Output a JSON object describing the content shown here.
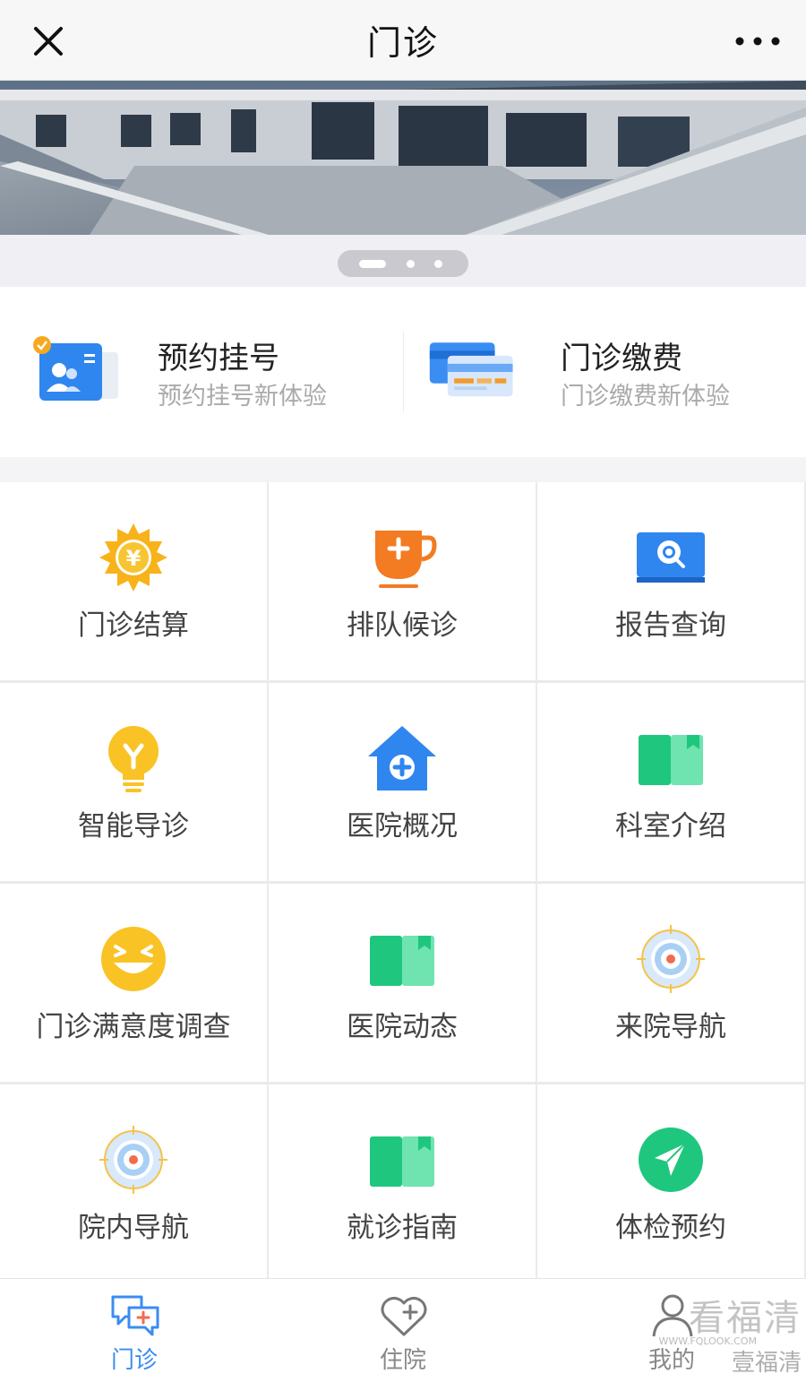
{
  "header": {
    "title": "门诊"
  },
  "quick": [
    {
      "title": "预约挂号",
      "subtitle": "预约挂号新体验"
    },
    {
      "title": "门诊缴费",
      "subtitle": "门诊缴费新体验"
    }
  ],
  "grid": [
    {
      "label": "门诊结算"
    },
    {
      "label": "排队候诊"
    },
    {
      "label": "报告查询"
    },
    {
      "label": "智能导诊"
    },
    {
      "label": "医院概况"
    },
    {
      "label": "科室介绍"
    },
    {
      "label": "门诊满意度调查"
    },
    {
      "label": "医院动态"
    },
    {
      "label": "来院导航"
    },
    {
      "label": "院内导航"
    },
    {
      "label": "就诊指南"
    },
    {
      "label": "体检预约"
    }
  ],
  "tabs": [
    {
      "label": "门诊",
      "active": true
    },
    {
      "label": "住院",
      "active": false
    },
    {
      "label": "我的",
      "active": false
    }
  ],
  "watermark": {
    "logo": "看福清",
    "url": "WWW.FQLOOK.COM",
    "account": "壹福清"
  },
  "colors": {
    "accent": "#3b8cf0",
    "green": "#1fc77e",
    "orange": "#f37b22",
    "yellow": "#f9c325"
  }
}
